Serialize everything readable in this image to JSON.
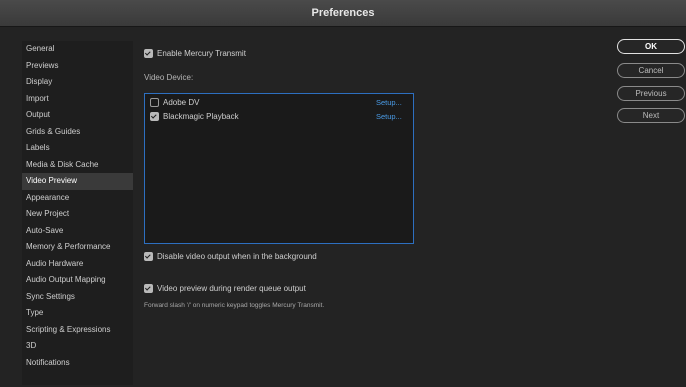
{
  "window": {
    "title": "Preferences"
  },
  "sidebar": {
    "items": [
      {
        "label": "General"
      },
      {
        "label": "Previews"
      },
      {
        "label": "Display"
      },
      {
        "label": "Import"
      },
      {
        "label": "Output"
      },
      {
        "label": "Grids & Guides"
      },
      {
        "label": "Labels"
      },
      {
        "label": "Media & Disk Cache"
      },
      {
        "label": "Video Preview"
      },
      {
        "label": "Appearance"
      },
      {
        "label": "New Project"
      },
      {
        "label": "Auto-Save"
      },
      {
        "label": "Memory & Performance"
      },
      {
        "label": "Audio Hardware"
      },
      {
        "label": "Audio Output Mapping"
      },
      {
        "label": "Sync Settings"
      },
      {
        "label": "Type"
      },
      {
        "label": "Scripting & Expressions"
      },
      {
        "label": "3D"
      },
      {
        "label": "Notifications"
      }
    ],
    "selected": "Video Preview"
  },
  "video_preview": {
    "enable_mercury": {
      "label": "Enable Mercury Transmit",
      "checked": true
    },
    "video_device_label": "Video Device:",
    "devices": [
      {
        "name": "Adobe DV",
        "checked": false,
        "setup": "Setup..."
      },
      {
        "name": "Blackmagic Playback",
        "checked": true,
        "setup": "Setup..."
      }
    ],
    "disable_background": {
      "label": "Disable video output when in the background",
      "checked": true
    },
    "render_queue": {
      "label": "Video preview during render queue output",
      "checked": true
    },
    "note": "Forward slash '/' on numeric keypad toggles Mercury Transmit."
  },
  "buttons": {
    "ok": "OK",
    "cancel": "Cancel",
    "previous": "Previous",
    "next": "Next"
  }
}
